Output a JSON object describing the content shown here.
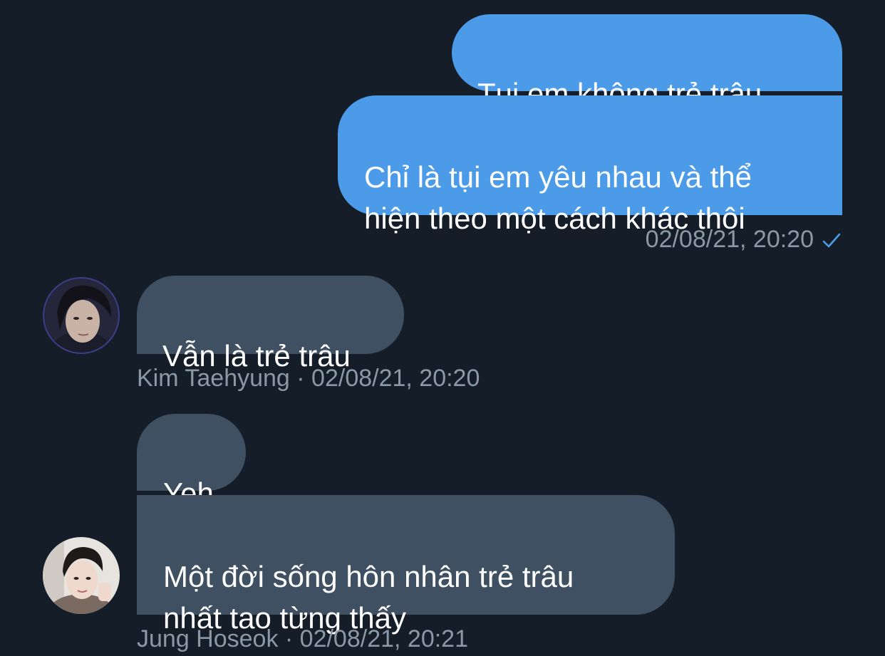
{
  "messages": {
    "sent_1": "Tụi em không trẻ trâu",
    "sent_2": "Chỉ là tụi em yêu nhau và thể\nhiện theo một cách khác thôi",
    "sent_time": "02/08/21, 20:20",
    "recv_1": "Vẫn là trẻ trâu",
    "recv_1_meta": "Kim Taehyung · 02/08/21, 20:20",
    "recv_2": "Yeh",
    "recv_3": "Một đời sống hôn nhân trẻ trâu\nnhất tao từng thấy",
    "recv_3_meta": "Jung Hoseok · 02/08/21, 20:21"
  },
  "colors": {
    "background": "#151d28",
    "sent_bubble": "#4c9be8",
    "received_bubble": "#3f5062",
    "meta_text": "#8b98a5",
    "read_check": "#4c9be8"
  },
  "icons": {
    "read_receipt": "check-icon"
  }
}
